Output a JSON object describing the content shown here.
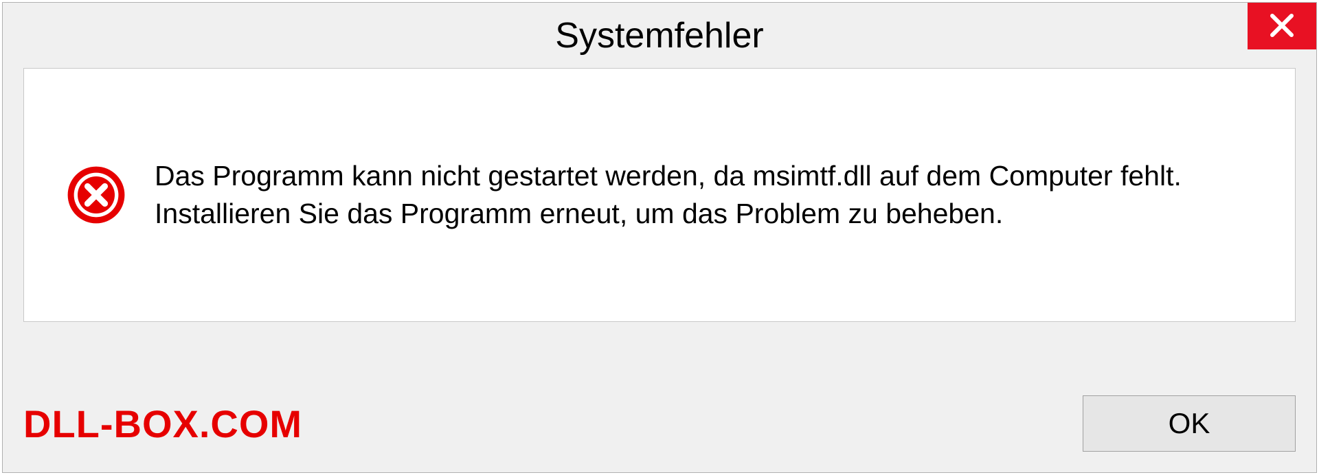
{
  "dialog": {
    "title": "Systemfehler",
    "message": "Das Programm kann nicht gestartet werden, da msimtf.dll auf dem Computer fehlt. Installieren Sie das Programm erneut, um das Problem zu beheben.",
    "ok_label": "OK"
  },
  "watermark": "DLL-BOX.COM"
}
